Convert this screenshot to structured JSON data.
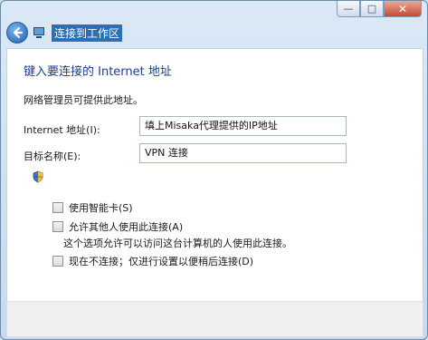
{
  "window": {
    "title": "连接到工作区",
    "caption_buttons": {
      "minimize": "—",
      "maximize": "□",
      "close": "✕"
    }
  },
  "page": {
    "heading": "键入要连接的 Internet 地址",
    "description": "网络管理员可提供此地址。",
    "internet_address": {
      "label": "Internet 地址(I):",
      "value": "填上Misaka代理提供的IP地址"
    },
    "destination_name": {
      "label": "目标名称(E):",
      "value": "VPN 连接"
    },
    "options": {
      "use_smart_card": "使用智能卡(S)",
      "allow_others": "允许其他人使用此连接(A)",
      "allow_others_note": "这个选项允许可以访问这台计算机的人使用此连接。",
      "dont_connect_now": "现在不连接；仅进行设置以便稍后连接(D)"
    }
  },
  "colors": {
    "heading": "#1e3f8a",
    "title_highlight": "#2b6fb6"
  }
}
